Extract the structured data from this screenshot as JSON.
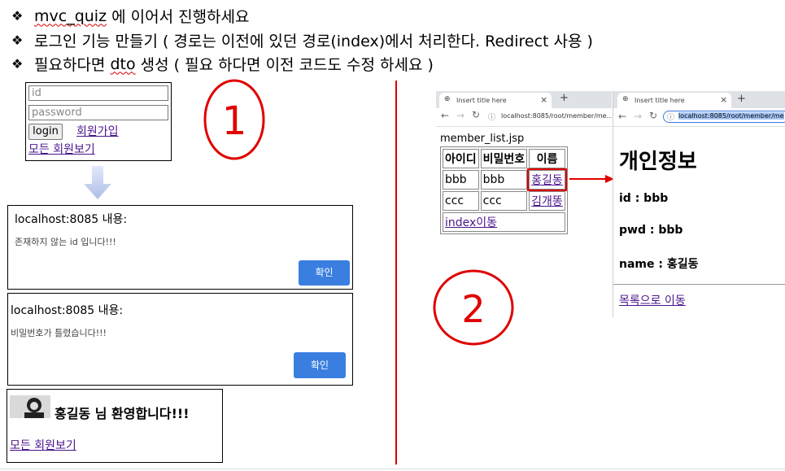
{
  "instructions": [
    {
      "text_a": "mvc_quiz",
      "text_b": " 에 이어서 진행하세요"
    },
    {
      "text_a": "로그인 기능 만들기 ( 경로는 이전에 있던 경로(index)에서 처리한다. Redirect 사용 )",
      "text_b": ""
    },
    {
      "text_a": "필요하다면 ",
      "text_b": "dto",
      "text_c": " 생성 ( 필요 하다면 이전 코드도 수정 하세요 )"
    }
  ],
  "bullet_symbol": "❖",
  "login_form": {
    "id_placeholder": "id",
    "password_placeholder": "password",
    "login_label": "login",
    "signup_link": "회원가입",
    "view_all_link": "모든 회원보기"
  },
  "dialog_id": {
    "title": "localhost:8085 내용:",
    "message": "존재하지 않는 id 입니다!!!",
    "ok": "확인"
  },
  "dialog_pw": {
    "title": "localhost:8085 내용:",
    "message": "비밀번호가 틀렸습니다!!!",
    "ok": "확인"
  },
  "welcome": {
    "message": "홍길동 님 환영합니다!!!",
    "view_all_link": "모든 회원보기"
  },
  "annotations": {
    "one": "1",
    "two": "2"
  },
  "browser_left": {
    "tab_title": "Insert title here",
    "url": "localhost:8085/root/member/me...",
    "page_heading": "member_list.jsp",
    "headers": [
      "아이디",
      "비밀번호",
      "이름"
    ],
    "rows": [
      [
        "bbb",
        "bbb",
        "홍길동"
      ],
      [
        "ccc",
        "ccc",
        "김개똥"
      ]
    ],
    "index_link": "index이동"
  },
  "browser_right": {
    "tab_title": "Insert title here",
    "url": "localhost:8085/root/member/me",
    "title": "개인정보",
    "id_line": "id : bbb",
    "pwd_line": "pwd : bbb",
    "name_line": "name : 홍길동",
    "back_link": "목록으로 이동"
  },
  "colors": {
    "accent_red": "#e00000",
    "ok_blue": "#3a7fe0",
    "link_purple": "#4a148c"
  }
}
